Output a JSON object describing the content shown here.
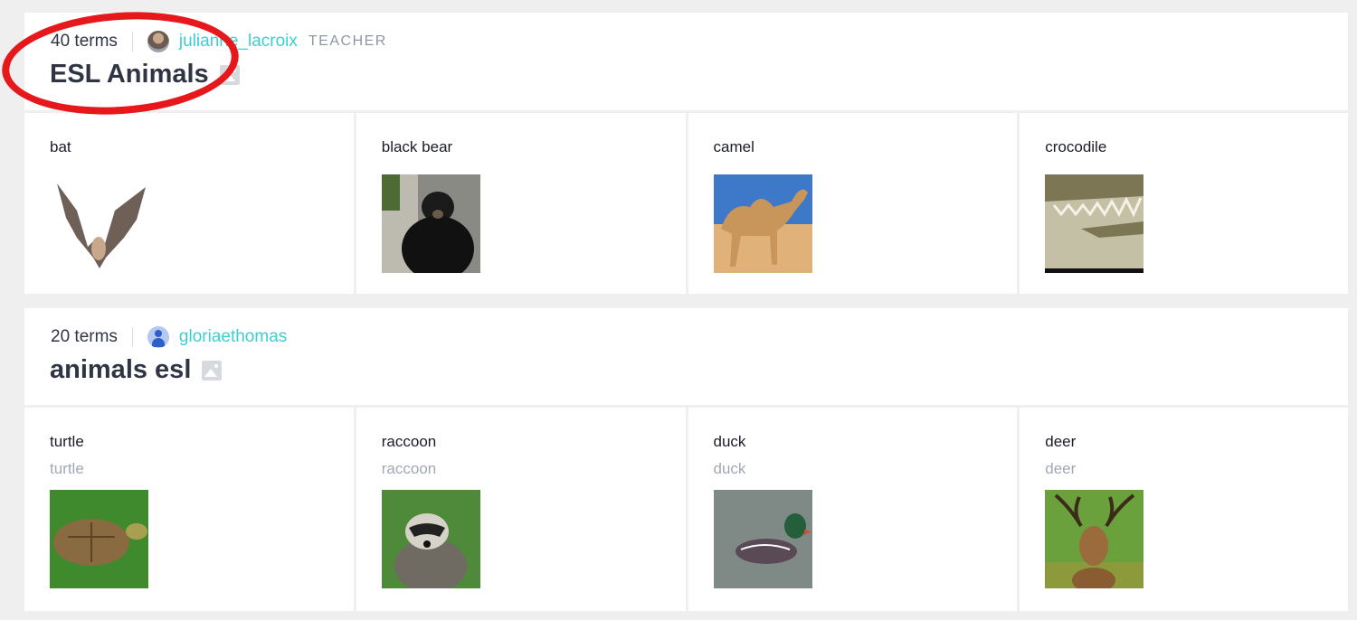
{
  "sets": [
    {
      "term_count": "40 terms",
      "username": "julianne_lacroix",
      "role": "TEACHER",
      "title": "ESL Animals",
      "avatar": "photo-avatar",
      "terms": [
        {
          "word": "bat",
          "definition": "",
          "image": "bat-photo"
        },
        {
          "word": "black bear",
          "definition": "",
          "image": "black-bear-photo"
        },
        {
          "word": "camel",
          "definition": "",
          "image": "camel-photo"
        },
        {
          "word": "crocodile",
          "definition": "",
          "image": "crocodile-photo"
        }
      ]
    },
    {
      "term_count": "20 terms",
      "username": "gloriaethomas",
      "role": "",
      "title": "animals esl",
      "avatar": "default-user-icon",
      "terms": [
        {
          "word": "turtle",
          "definition": "turtle",
          "image": "turtle-photo"
        },
        {
          "word": "raccoon",
          "definition": "raccoon",
          "image": "raccoon-photo"
        },
        {
          "word": "duck",
          "definition": "duck",
          "image": "duck-photo"
        },
        {
          "word": "deer",
          "definition": "deer",
          "image": "deer-photo"
        }
      ]
    }
  ],
  "colors": {
    "link": "#3ccfcf",
    "annotation": "#e6181c",
    "background": "#efefef"
  }
}
